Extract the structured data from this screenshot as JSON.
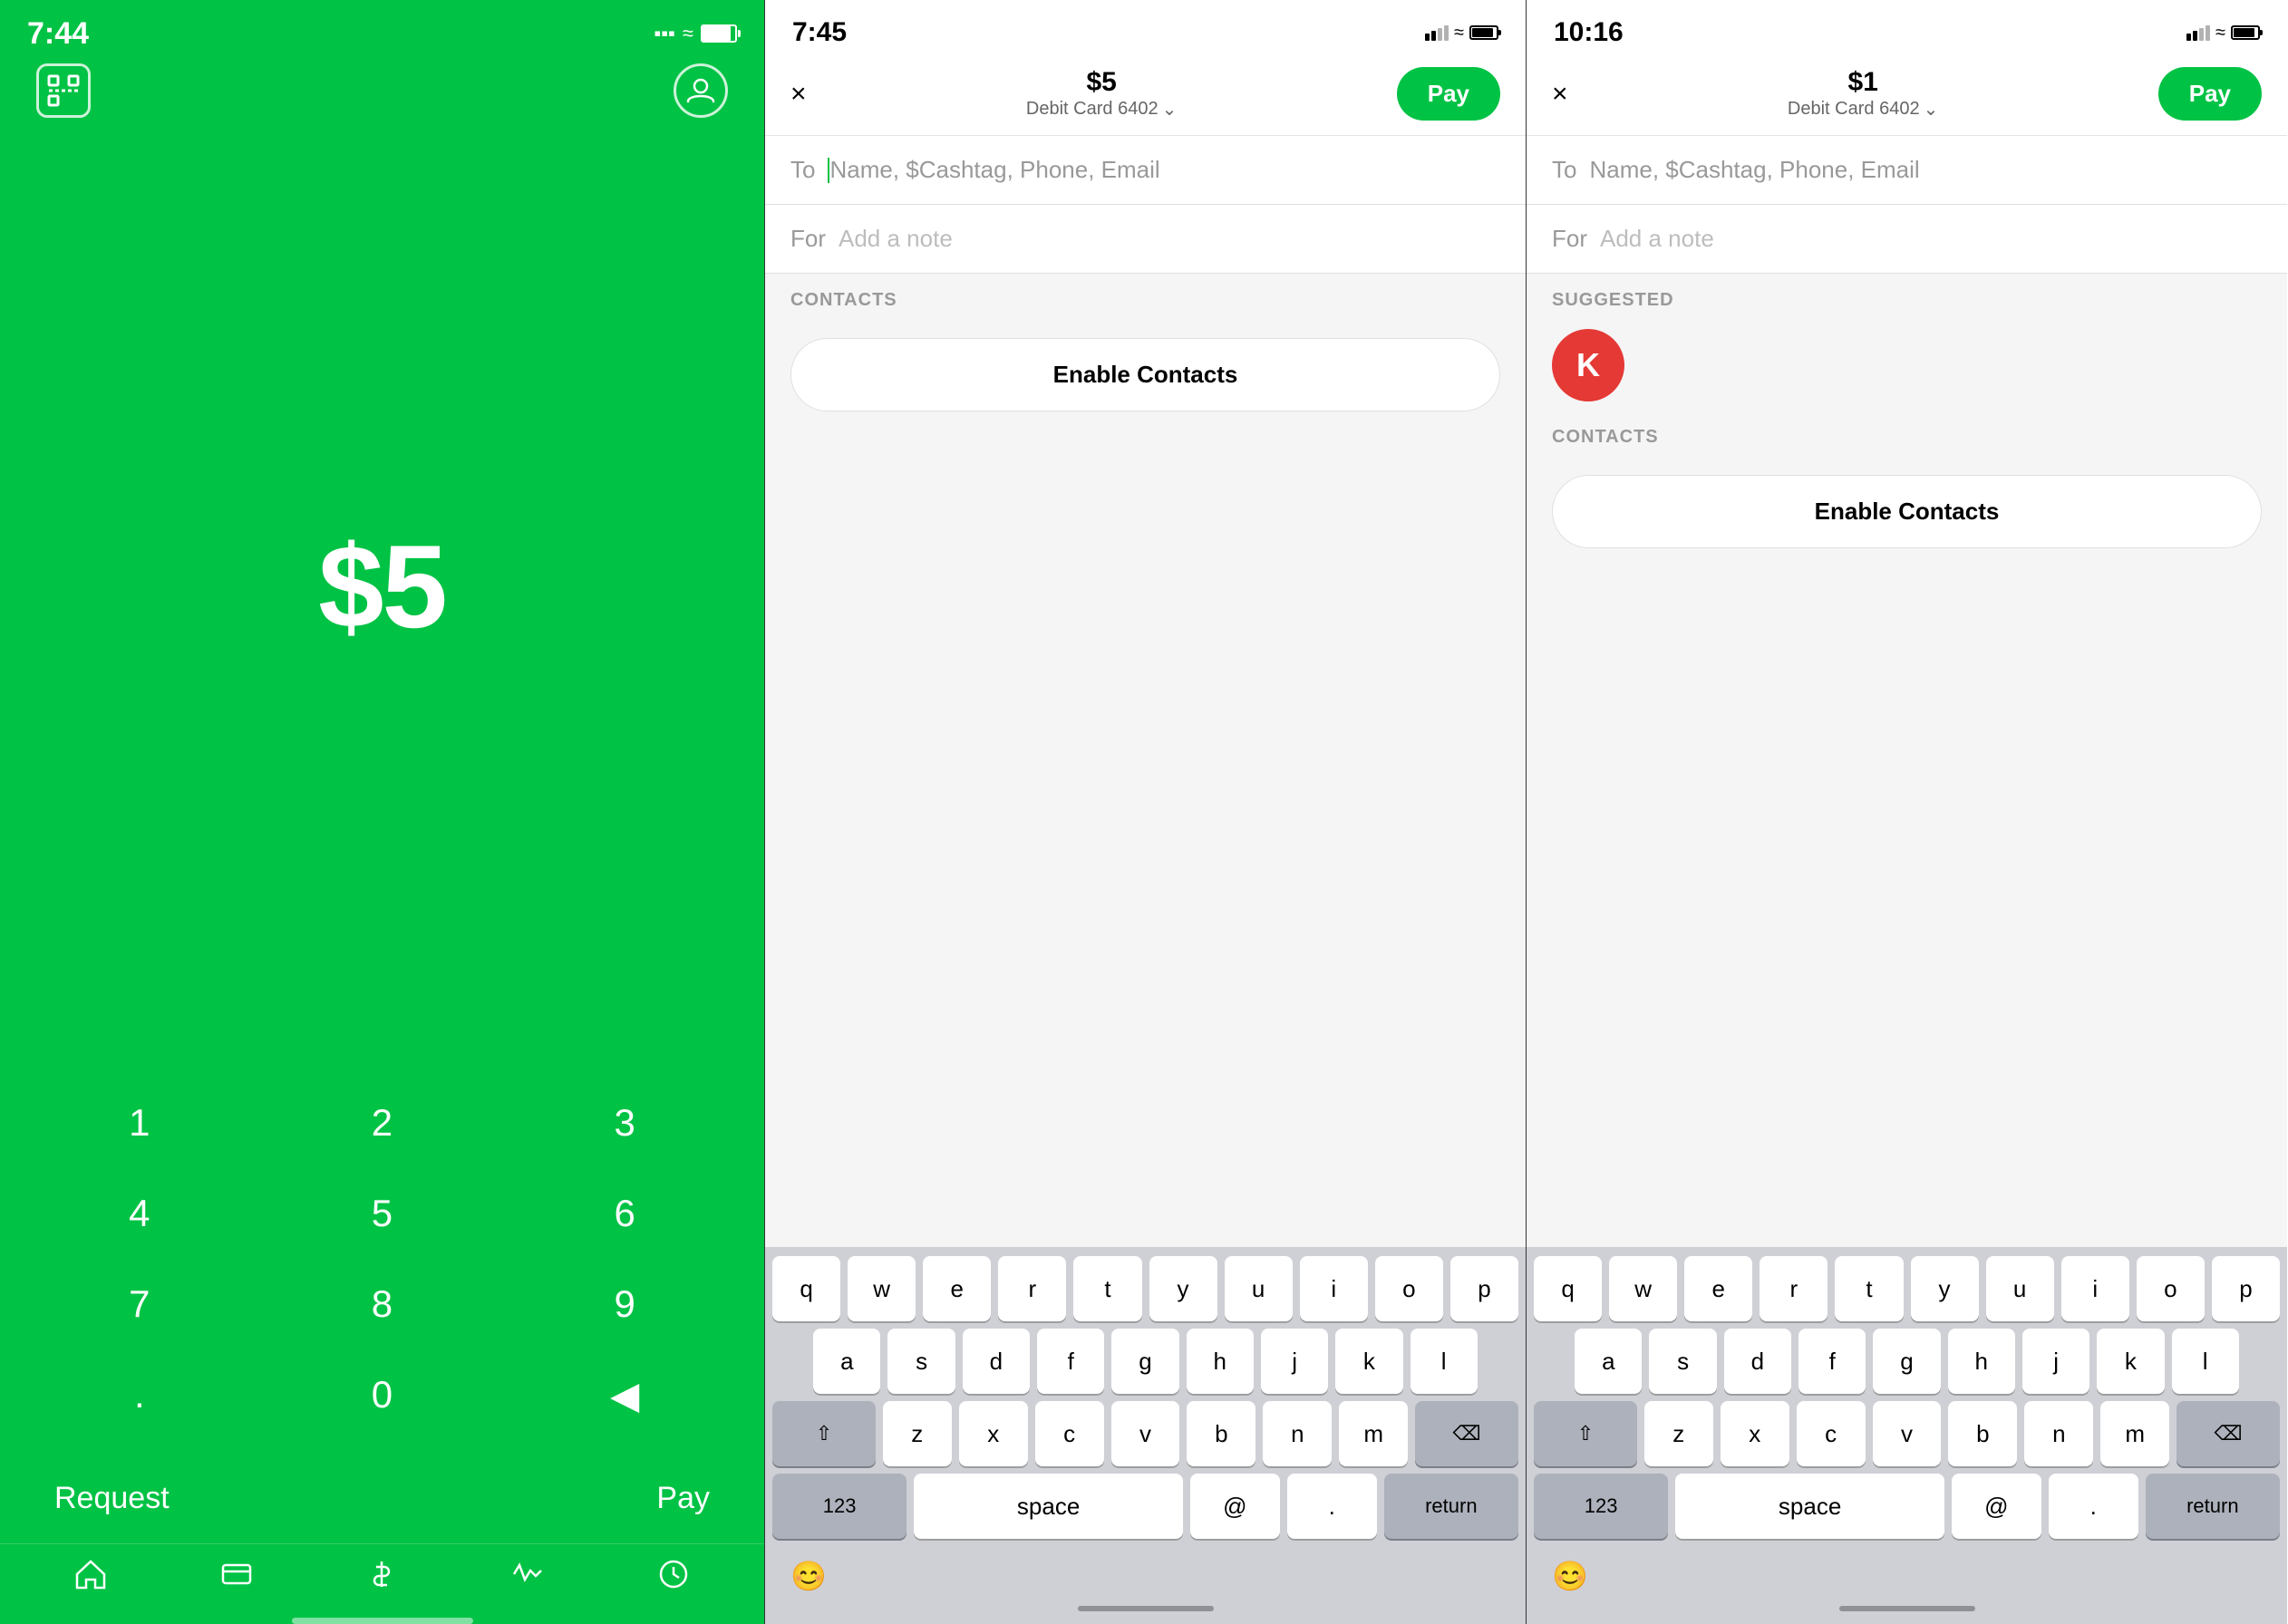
{
  "screen1": {
    "status_time": "7:44",
    "amount": "$5",
    "numpad": {
      "keys": [
        "1",
        "2",
        "3",
        "4",
        "5",
        "6",
        "7",
        "8",
        "9",
        ".",
        "0",
        "⌫"
      ]
    },
    "request_label": "Request",
    "pay_label": "Pay",
    "nav_items": [
      "home",
      "card",
      "dollar",
      "activity",
      "clock"
    ]
  },
  "screen2": {
    "status_time": "7:45",
    "header": {
      "amount": "$5",
      "card": "Debit Card 6402",
      "pay_label": "Pay",
      "close": "×"
    },
    "to_label": "To",
    "to_placeholder": "Name, $Cashtag, Phone, Email",
    "for_label": "For",
    "for_placeholder": "Add a note",
    "contacts_label": "CONTACTS",
    "enable_contacts_label": "Enable Contacts",
    "keyboard": {
      "rows": [
        [
          "q",
          "w",
          "e",
          "r",
          "t",
          "y",
          "u",
          "i",
          "o",
          "p"
        ],
        [
          "a",
          "s",
          "d",
          "f",
          "g",
          "h",
          "j",
          "k",
          "l"
        ],
        [
          "z",
          "x",
          "c",
          "v",
          "b",
          "n",
          "m"
        ],
        [
          "123",
          "space",
          "@",
          ".",
          "return"
        ]
      ]
    }
  },
  "screen3": {
    "status_time": "10:16",
    "header": {
      "amount": "$1",
      "card": "Debit Card 6402",
      "pay_label": "Pay",
      "close": "×"
    },
    "to_label": "To",
    "to_placeholder": "Name, $Cashtag, Phone, Email",
    "for_label": "For",
    "for_placeholder": "Add a note",
    "suggested_label": "SUGGESTED",
    "suggested_avatar": "K",
    "contacts_label": "CONTACTS",
    "enable_contacts_label": "Enable Contacts",
    "keyboard": {
      "rows": [
        [
          "q",
          "w",
          "e",
          "r",
          "t",
          "y",
          "u",
          "i",
          "o",
          "p"
        ],
        [
          "a",
          "s",
          "d",
          "f",
          "g",
          "h",
          "j",
          "k",
          "l"
        ],
        [
          "z",
          "x",
          "c",
          "v",
          "b",
          "n",
          "m"
        ],
        [
          "123",
          "space",
          "@",
          ".",
          "return"
        ]
      ]
    }
  }
}
